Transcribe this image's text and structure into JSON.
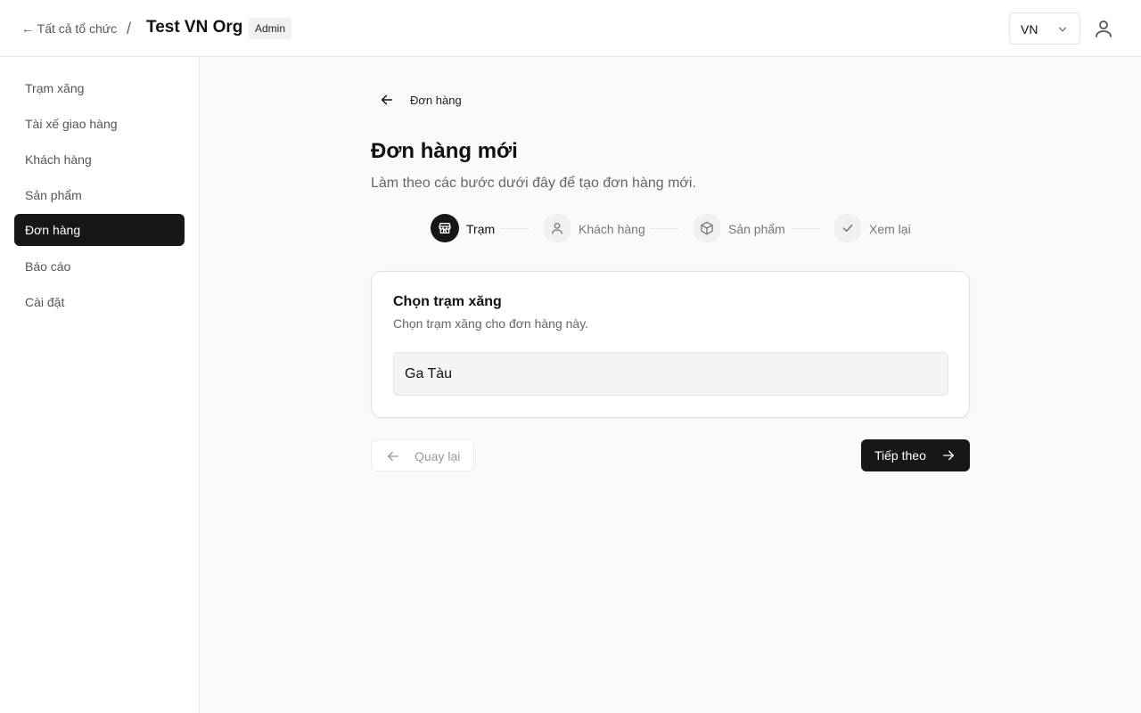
{
  "header": {
    "back_all_label": "← Tất cả tổ chức",
    "separator": "/",
    "org_name": "Test VN Org",
    "role_badge": "Admin",
    "language": "VN",
    "icons": [
      "chevron-down-icon",
      "user-icon"
    ]
  },
  "sidebar": {
    "items": [
      {
        "label": "Trạm xăng",
        "active": false
      },
      {
        "label": "Tài xế giao hàng",
        "active": false
      },
      {
        "label": "Khách hàng",
        "active": false
      },
      {
        "label": "Sản phẩm",
        "active": false
      },
      {
        "label": "Đơn hàng",
        "active": true
      },
      {
        "label": "Báo cáo",
        "active": false
      },
      {
        "label": "Cài đặt",
        "active": false
      }
    ]
  },
  "main": {
    "back_link": "Đơn hàng",
    "title": "Đơn hàng mới",
    "subtitle": "Làm theo các bước dưới đây để tạo đơn hàng mới.",
    "steps": [
      {
        "label": "Trạm",
        "icon": "store-icon",
        "active": true
      },
      {
        "label": "Khách hàng",
        "icon": "user-icon",
        "active": false
      },
      {
        "label": "Sản phẩm",
        "icon": "package-icon",
        "active": false
      },
      {
        "label": "Xem lại",
        "icon": "check-icon",
        "active": false
      }
    ],
    "card": {
      "title": "Chọn trạm xăng",
      "subtitle": "Chọn trạm xăng cho đơn hàng này.",
      "selected_station": "Ga Tàu"
    },
    "buttons": {
      "back": "Quay lại",
      "next": "Tiếp theo"
    }
  },
  "colors": {
    "accent": "#171717",
    "background": "#fafafa",
    "muted_text": "#666666",
    "border": "#e6e6e6"
  }
}
